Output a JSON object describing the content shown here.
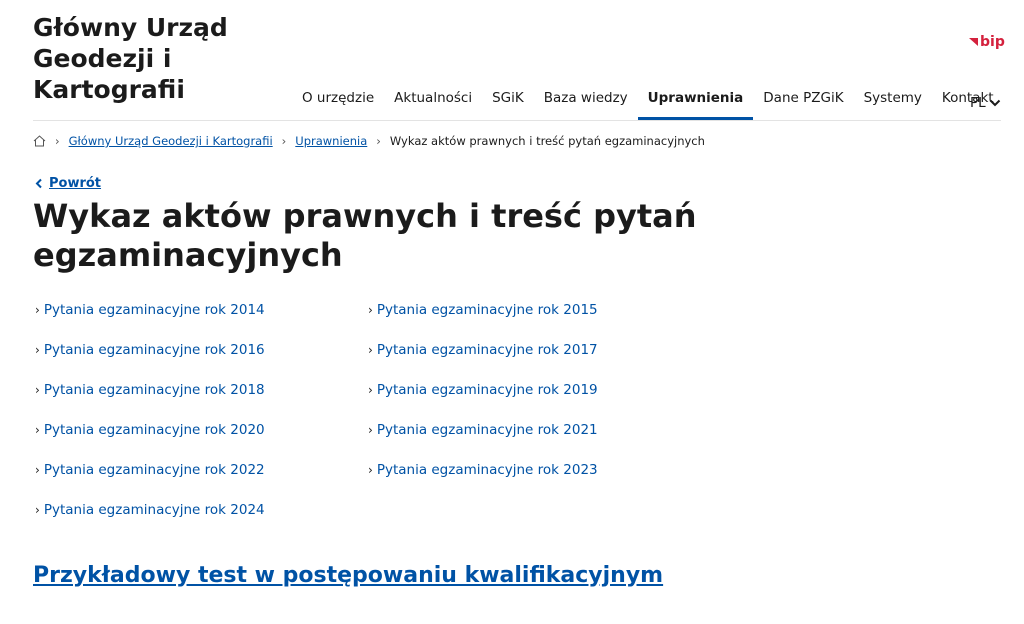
{
  "site": {
    "title_lines": [
      "Główny Urząd",
      "Geodezji i",
      "Kartografii"
    ],
    "bip_label": "bip",
    "colors": {
      "accent": "#0052a5",
      "bip_red": "#d4213d",
      "text": "#1b1b1b"
    }
  },
  "nav": {
    "items": [
      "O urzędzie",
      "Aktualności",
      "SGiK",
      "Baza wiedzy",
      "Uprawnienia",
      "Dane PZGiK",
      "Systemy",
      "Kontakt"
    ],
    "active": "Uprawnienia",
    "lang": "PL"
  },
  "breadcrumb": {
    "home_icon": "home-icon",
    "items": [
      "Główny Urząd Geodezji i Kartografii",
      "Uprawnienia",
      "Wykaz aktów prawnych i treść pytań egzaminacyjnych"
    ]
  },
  "back": {
    "label": "Powrót"
  },
  "page": {
    "title": "Wykaz aktów prawnych i treść pytań egzaminacyjnych",
    "links": [
      "Pytania egzaminacyjne rok 2014",
      "Pytania egzaminacyjne rok 2015",
      "Pytania egzaminacyjne rok 2016",
      "Pytania egzaminacyjne rok 2017",
      "Pytania egzaminacyjne rok 2018",
      "Pytania egzaminacyjne rok 2019",
      "Pytania egzaminacyjne rok 2020",
      "Pytania egzaminacyjne rok 2021",
      "Pytania egzaminacyjne rok 2022",
      "Pytania egzaminacyjne rok 2023",
      "Pytania egzaminacyjne rok 2024"
    ],
    "sample_test": "Przykładowy test w postępowaniu kwalifikacyjnym"
  }
}
